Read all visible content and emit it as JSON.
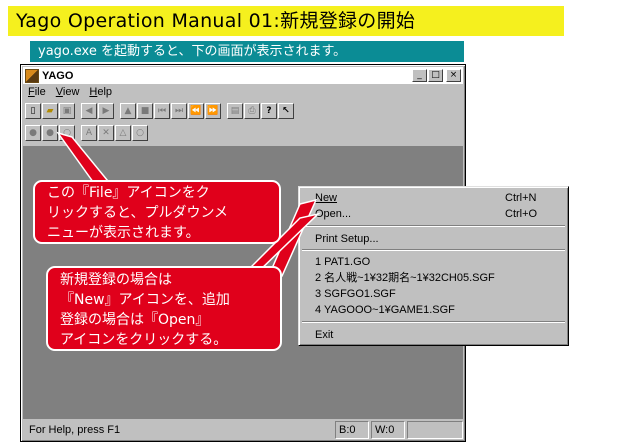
{
  "banner": {
    "title": "Yago Operation Manual 01:新規登録の開始",
    "subtitle": "yago.exe を起動すると、下の画面が表示されます。"
  },
  "window": {
    "title": "YAGO",
    "controls": {
      "minimize": "_",
      "maximize": "□",
      "close": "×"
    },
    "menu": {
      "file": "File",
      "view": "View",
      "help": "Help"
    },
    "status": {
      "text": "For Help, press F1",
      "b": "B:0",
      "w": "W:0"
    }
  },
  "toolbar": {
    "row1": [
      "new-icon",
      "open-icon",
      "save-icon",
      "rewind-icon",
      "forward-icon",
      "eject-icon",
      "stop-icon",
      "first-icon",
      "last-icon",
      "prev-icon",
      "next-icon",
      "info-icon",
      "print-icon",
      "help-icon",
      "context-help-icon"
    ],
    "row2": [
      "black-stone-icon",
      "white-stone-icon",
      "circle-mark-icon",
      "letter-mark-icon",
      "cross-mark-icon",
      "triangle-mark-icon",
      "small-circle-mark-icon"
    ],
    "row2_glyphs": [
      "●",
      "●",
      "○",
      "A",
      "✕",
      "△",
      "○"
    ]
  },
  "file_menu": {
    "new": "New",
    "new_shortcut": "Ctrl+N",
    "open": "Open...",
    "open_shortcut": "Ctrl+O",
    "print_setup": "Print Setup...",
    "recent": [
      "1 PAT1.GO",
      "2 名人戦~1¥32期名~1¥32CH05.SGF",
      "3 SGFGO1.SGF",
      "4 YAGOOO~1¥GAME1.SGF"
    ],
    "exit": "Exit"
  },
  "callouts": {
    "file_icon": [
      "この『File』アイコンをク",
      "リックすると、プルダウンメ",
      "ニューが表示されます。"
    ],
    "new_open": [
      "新規登録の場合は",
      "『New』アイコンを、追加",
      "登録の場合は『Open』",
      "アイコンをクリックする。"
    ]
  },
  "colors": {
    "title_bg": "#f5f01e",
    "subtitle_bg": "#0b8c95",
    "callout_bg": "#e0001b",
    "workspace": "#808080",
    "window_face": "#c0c0c0"
  }
}
